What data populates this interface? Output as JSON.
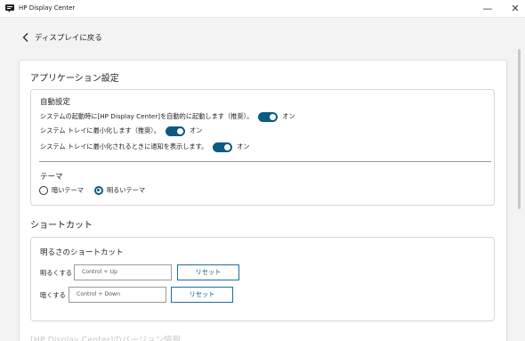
{
  "window": {
    "title": "HP Display Center",
    "minimize": "—",
    "close": "✕"
  },
  "nav": {
    "back_label": "ディスプレイに戻る"
  },
  "app_settings": {
    "title": "アプリケーション設定",
    "auto": {
      "title": "自動設定",
      "items": [
        {
          "label": "システムの起動時に[HP Display Center]を自動的に起動します（推奨）。",
          "state": "オン",
          "on": true
        },
        {
          "label": "システム トレイに最小化します（推奨）。",
          "state": "オン",
          "on": true
        },
        {
          "label": "システム トレイに最小化されるときに通知を表示します。",
          "state": "オン",
          "on": true
        }
      ]
    },
    "theme": {
      "title": "テーマ",
      "options": [
        {
          "label": "暗いテーマ",
          "selected": false
        },
        {
          "label": "明るいテーマ",
          "selected": true
        }
      ]
    }
  },
  "shortcuts": {
    "title": "ショートカット",
    "card_title": "明るさのショートカット",
    "rows": [
      {
        "label": "明るくする",
        "value": "Control + Up",
        "reset": "リセット"
      },
      {
        "label": "暗くする",
        "value": "Control + Down",
        "reset": "リセット"
      }
    ]
  },
  "version": {
    "title": "[HP Display Center]のバージョン情報"
  },
  "colors": {
    "accent": "#0b5a82",
    "button_border": "#1b6ea0"
  }
}
